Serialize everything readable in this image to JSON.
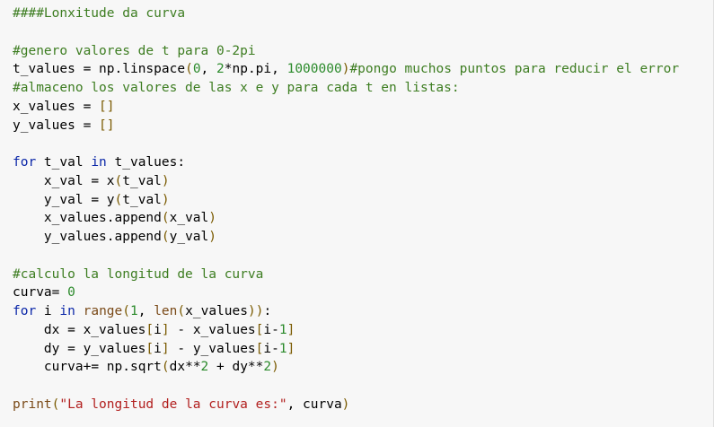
{
  "code_cell": {
    "lines": [
      [
        {
          "t": "####Lonxitude da curva",
          "c": "com"
        }
      ],
      [],
      [
        {
          "t": "#genero valores de t para 0-2pi",
          "c": "com"
        }
      ],
      [
        {
          "t": "t_values ",
          "c": "var"
        },
        {
          "t": "=",
          "c": "var"
        },
        {
          "t": " np.linspace",
          "c": "var"
        },
        {
          "t": "(",
          "c": "p"
        },
        {
          "t": "0",
          "c": "num"
        },
        {
          "t": ", ",
          "c": "var"
        },
        {
          "t": "2",
          "c": "num"
        },
        {
          "t": "*",
          "c": "var"
        },
        {
          "t": "np.pi, ",
          "c": "var"
        },
        {
          "t": "1000000",
          "c": "num"
        },
        {
          "t": ")",
          "c": "p"
        },
        {
          "t": "#pongo muchos puntos para reducir el error",
          "c": "com"
        }
      ],
      [
        {
          "t": "#almaceno los valores de las x e y para cada t en listas:",
          "c": "com"
        }
      ],
      [
        {
          "t": "x_values ",
          "c": "var"
        },
        {
          "t": "=",
          "c": "var"
        },
        {
          "t": " ",
          "c": "var"
        },
        {
          "t": "[]",
          "c": "p"
        }
      ],
      [
        {
          "t": "y_values ",
          "c": "var"
        },
        {
          "t": "=",
          "c": "var"
        },
        {
          "t": " ",
          "c": "var"
        },
        {
          "t": "[]",
          "c": "p"
        }
      ],
      [],
      [
        {
          "t": "for",
          "c": "kw"
        },
        {
          "t": " t_val ",
          "c": "var"
        },
        {
          "t": "in",
          "c": "kw"
        },
        {
          "t": " t_values:",
          "c": "var"
        }
      ],
      [
        {
          "t": "    x_val ",
          "c": "var"
        },
        {
          "t": "=",
          "c": "var"
        },
        {
          "t": " x",
          "c": "var"
        },
        {
          "t": "(",
          "c": "p"
        },
        {
          "t": "t_val",
          "c": "var"
        },
        {
          "t": ")",
          "c": "p"
        }
      ],
      [
        {
          "t": "    y_val ",
          "c": "var"
        },
        {
          "t": "=",
          "c": "var"
        },
        {
          "t": " y",
          "c": "var"
        },
        {
          "t": "(",
          "c": "p"
        },
        {
          "t": "t_val",
          "c": "var"
        },
        {
          "t": ")",
          "c": "p"
        }
      ],
      [
        {
          "t": "    x_values.append",
          "c": "var"
        },
        {
          "t": "(",
          "c": "p"
        },
        {
          "t": "x_val",
          "c": "var"
        },
        {
          "t": ")",
          "c": "p"
        }
      ],
      [
        {
          "t": "    y_values.append",
          "c": "var"
        },
        {
          "t": "(",
          "c": "p"
        },
        {
          "t": "y_val",
          "c": "var"
        },
        {
          "t": ")",
          "c": "p"
        }
      ],
      [],
      [
        {
          "t": "#calculo la longitud de la curva",
          "c": "com"
        }
      ],
      [
        {
          "t": "curva",
          "c": "var"
        },
        {
          "t": "=",
          "c": "var"
        },
        {
          "t": " ",
          "c": "var"
        },
        {
          "t": "0",
          "c": "num"
        }
      ],
      [
        {
          "t": "for",
          "c": "kw"
        },
        {
          "t": " i ",
          "c": "var"
        },
        {
          "t": "in",
          "c": "kw"
        },
        {
          "t": " ",
          "c": "var"
        },
        {
          "t": "range",
          "c": "bi"
        },
        {
          "t": "(",
          "c": "p"
        },
        {
          "t": "1",
          "c": "num"
        },
        {
          "t": ", ",
          "c": "var"
        },
        {
          "t": "len",
          "c": "bi"
        },
        {
          "t": "(",
          "c": "p"
        },
        {
          "t": "x_values",
          "c": "var"
        },
        {
          "t": "))",
          "c": "p"
        },
        {
          "t": ":",
          "c": "var"
        }
      ],
      [
        {
          "t": "    dx ",
          "c": "var"
        },
        {
          "t": "=",
          "c": "var"
        },
        {
          "t": " x_values",
          "c": "var"
        },
        {
          "t": "[",
          "c": "p"
        },
        {
          "t": "i",
          "c": "var"
        },
        {
          "t": "]",
          "c": "p"
        },
        {
          "t": " - x_values",
          "c": "var"
        },
        {
          "t": "[",
          "c": "p"
        },
        {
          "t": "i-",
          "c": "var"
        },
        {
          "t": "1",
          "c": "num"
        },
        {
          "t": "]",
          "c": "p"
        }
      ],
      [
        {
          "t": "    dy ",
          "c": "var"
        },
        {
          "t": "=",
          "c": "var"
        },
        {
          "t": " y_values",
          "c": "var"
        },
        {
          "t": "[",
          "c": "p"
        },
        {
          "t": "i",
          "c": "var"
        },
        {
          "t": "]",
          "c": "p"
        },
        {
          "t": " - y_values",
          "c": "var"
        },
        {
          "t": "[",
          "c": "p"
        },
        {
          "t": "i-",
          "c": "var"
        },
        {
          "t": "1",
          "c": "num"
        },
        {
          "t": "]",
          "c": "p"
        }
      ],
      [
        {
          "t": "    curva+",
          "c": "var"
        },
        {
          "t": "=",
          "c": "var"
        },
        {
          "t": " np.sqrt",
          "c": "var"
        },
        {
          "t": "(",
          "c": "p"
        },
        {
          "t": "dx**",
          "c": "var"
        },
        {
          "t": "2",
          "c": "num"
        },
        {
          "t": " + dy**",
          "c": "var"
        },
        {
          "t": "2",
          "c": "num"
        },
        {
          "t": ")",
          "c": "p"
        }
      ],
      [],
      [
        {
          "t": "print",
          "c": "bi"
        },
        {
          "t": "(",
          "c": "p"
        },
        {
          "t": "\"La longitud de la curva es:\"",
          "c": "str"
        },
        {
          "t": ", curva",
          "c": "var"
        },
        {
          "t": ")",
          "c": "p"
        }
      ]
    ]
  }
}
